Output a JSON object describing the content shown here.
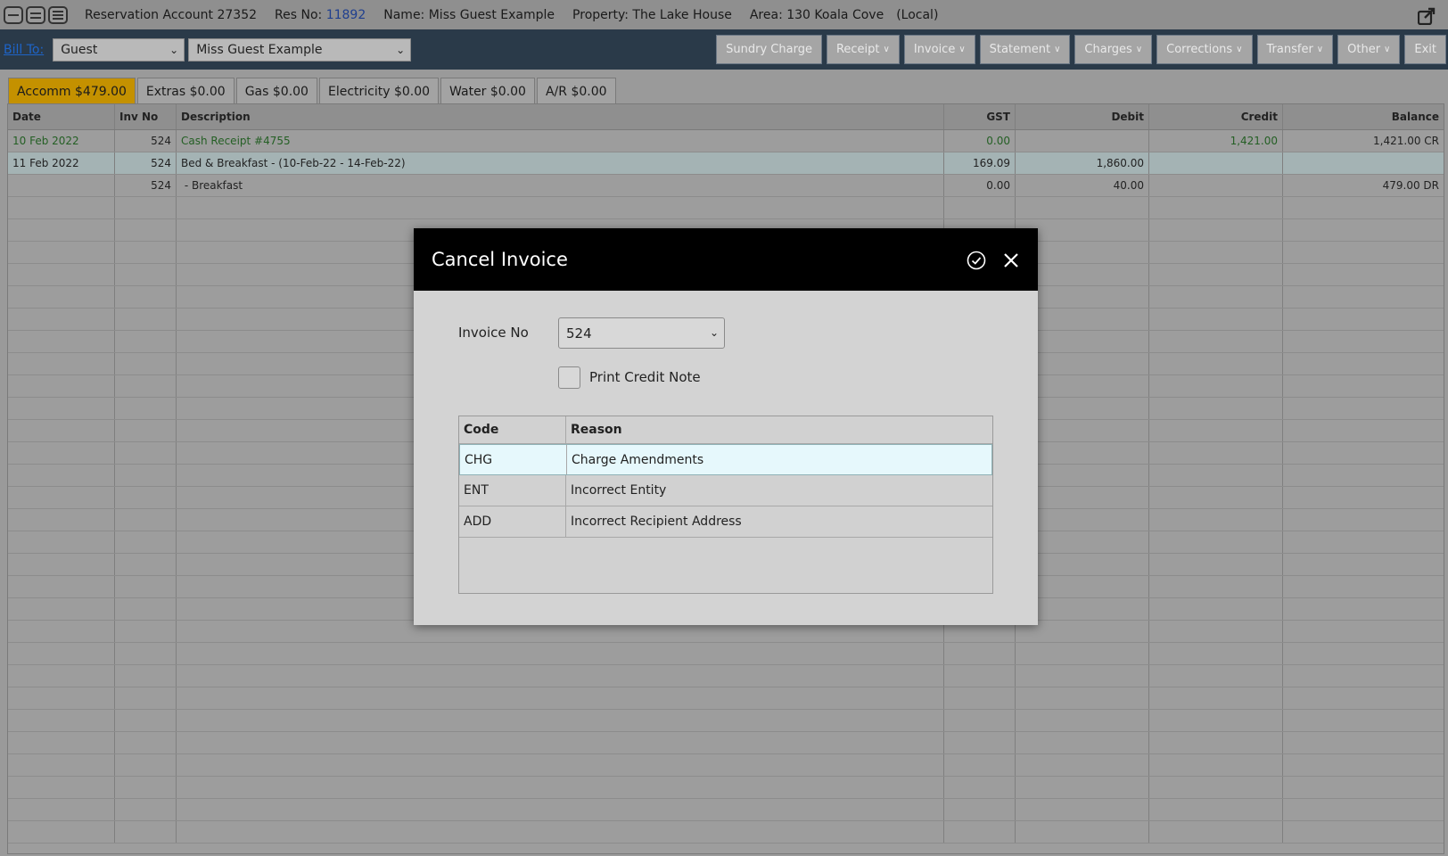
{
  "header": {
    "account": "Reservation Account 27352",
    "res_label": "Res No:",
    "res_no": "11892",
    "name": "Name: Miss Guest Example",
    "property": "Property: The Lake House",
    "area": "Area: 130 Koala Cove",
    "local": "(Local)"
  },
  "toolbar": {
    "bill_to_label": "Bill To:",
    "bill_to_type": "Guest",
    "bill_to_name": "Miss Guest Example",
    "buttons": {
      "sundry": "Sundry Charge",
      "receipt": "Receipt",
      "invoice": "Invoice",
      "statement": "Statement",
      "charges": "Charges",
      "corrections": "Corrections",
      "transfer": "Transfer",
      "other": "Other",
      "exit": "Exit"
    }
  },
  "tabs": {
    "accomm": "Accomm $479.00",
    "extras": "Extras $0.00",
    "gas": "Gas $0.00",
    "electricity": "Electricity $0.00",
    "water": "Water $0.00",
    "ar": "A/R $0.00"
  },
  "grid": {
    "columns": {
      "date": "Date",
      "inv_no": "Inv No",
      "description": "Description",
      "gst": "GST",
      "debit": "Debit",
      "credit": "Credit",
      "balance": "Balance"
    },
    "rows": [
      {
        "date": "10 Feb 2022",
        "inv_no": "524",
        "description": "Cash Receipt #4755",
        "gst": "0.00",
        "debit": "",
        "credit": "1,421.00",
        "balance": "1,421.00 CR"
      },
      {
        "date": "11 Feb 2022",
        "inv_no": "524",
        "description": "Bed & Breakfast - (10-Feb-22 - 14-Feb-22)",
        "gst": "169.09",
        "debit": "1,860.00",
        "credit": "",
        "balance": ""
      },
      {
        "date": "",
        "inv_no": "524",
        "description": " - Breakfast",
        "gst": "0.00",
        "debit": "40.00",
        "credit": "",
        "balance": "479.00 DR"
      }
    ]
  },
  "modal": {
    "title": "Cancel Invoice",
    "invoice_label": "Invoice No",
    "invoice_value": "524",
    "print_credit_label": "Print Credit Note",
    "print_credit_checked": false,
    "reasons_header": {
      "code": "Code",
      "reason": "Reason"
    },
    "reasons": [
      {
        "code": "CHG",
        "reason": "Charge Amendments"
      },
      {
        "code": "ENT",
        "reason": "Incorrect Entity"
      },
      {
        "code": "ADD",
        "reason": "Incorrect Recipient Address"
      }
    ]
  }
}
